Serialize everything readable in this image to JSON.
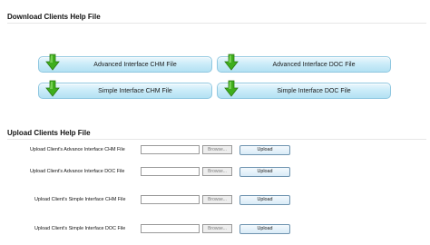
{
  "download_section": {
    "title": "Download Clients Help File",
    "buttons": [
      {
        "label": "Advanced Interface CHM File",
        "icon": "green-down-arrow-icon"
      },
      {
        "label": "Advanced Interface DOC File",
        "icon": "green-down-arrow-icon"
      },
      {
        "label": "Simple Interface CHM File",
        "icon": "green-down-arrow-icon"
      },
      {
        "label": "Simple Interface DOC File",
        "icon": "green-down-arrow-icon"
      }
    ]
  },
  "upload_section": {
    "title": "Upload Clients Help File",
    "rows": [
      {
        "label": "Upload Client's Advance Interface CHM File",
        "browse": "Browse...",
        "upload": "Upload"
      },
      {
        "label": "Upload Client's Advance Interface DOC File",
        "browse": "Browse...",
        "upload": "Upload"
      },
      {
        "label": "Upload Client's Simple Interface CHM File",
        "browse": "Browse...",
        "upload": "Upload"
      },
      {
        "label": "Upload Client's Simple Interface DOC File",
        "browse": "Browse...",
        "upload": "Upload"
      }
    ]
  },
  "colors": {
    "button_border": "#8fc7e0",
    "button_fill": "#c9ebf8",
    "arrow_green": "#3fae1c"
  }
}
